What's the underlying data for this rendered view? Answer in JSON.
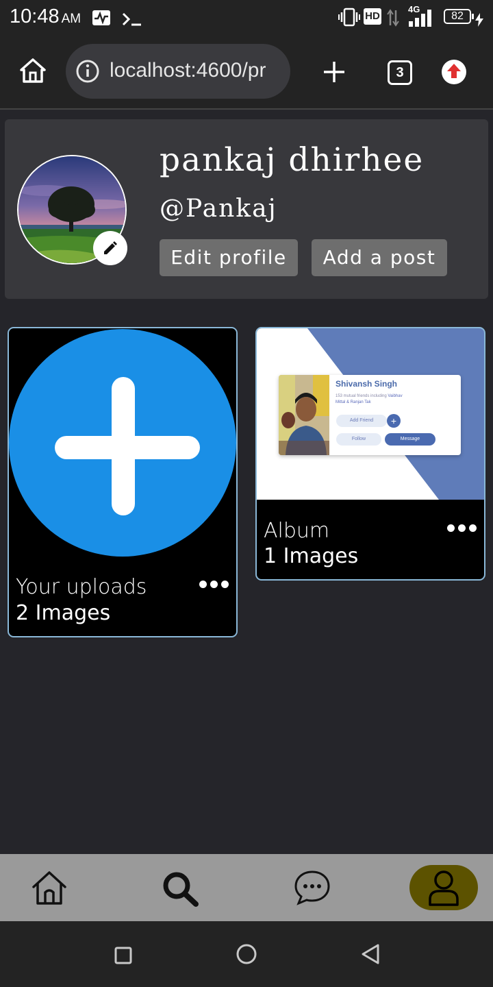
{
  "status_bar": {
    "time": "10:48",
    "ampm": "AM",
    "network": "4G",
    "hd_label": "HD",
    "battery": "82"
  },
  "browser": {
    "url": "localhost:4600/pr",
    "tab_count": "3"
  },
  "profile": {
    "name": "pankaj dhirhee",
    "handle": "@Pankaj",
    "edit_profile_label": "Edit profile",
    "add_post_label": "Add a post"
  },
  "albums": [
    {
      "title": "Your uploads",
      "count": "2 Images",
      "thumb": "add-icon"
    },
    {
      "title": "Album",
      "count": "1 Images",
      "thumb_card": {
        "person": "Shivansh Singh",
        "mutual": "153 mutual friends including",
        "mutual_names_1": "Vaibhav",
        "mutual_names_2": "Mittal & Ranjan Tak",
        "add_friend": "Add Friend",
        "follow": "Follow",
        "message": "Message"
      }
    }
  ],
  "bottom_nav": {
    "items": [
      "home-icon",
      "search-icon",
      "chat-icon",
      "profile-icon"
    ],
    "active": "profile-icon",
    "active_color": "#5c5200"
  },
  "colors": {
    "accent_blue": "#1a8fe6",
    "card_border": "#8ab8d8"
  }
}
